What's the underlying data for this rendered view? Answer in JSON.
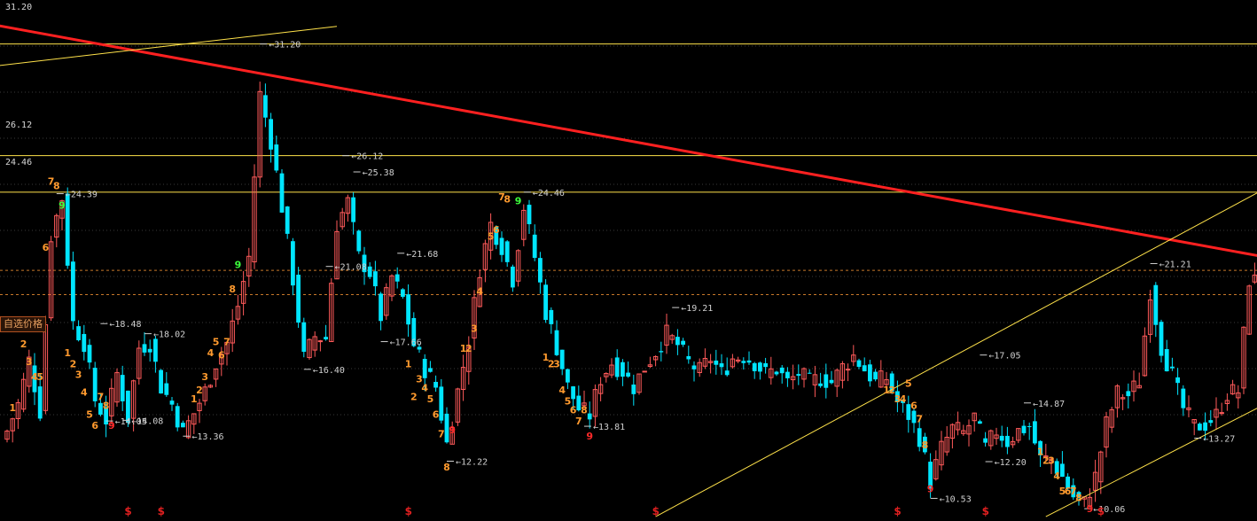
{
  "levels": {
    "top": "31.20",
    "l2612": "26.12",
    "l2446": "24.46"
  },
  "price_tag": "自选价格",
  "flag_glyph": "$",
  "colors": {
    "up": "#ff5a5a",
    "down": "#00e5ff",
    "trend": "#ff2020",
    "level": "#ffe24a",
    "grid": "#3a3a3a",
    "dash": "#c8782a",
    "count_orange": "#ff9a2e",
    "count_green": "#3cff3c",
    "count_red": "#ff2a2a"
  },
  "chart_data": {
    "type": "candlestick",
    "x": "bar index",
    "y_range": [
      9.5,
      33.2
    ],
    "horizontal_levels": [
      31.2,
      26.12,
      24.46
    ],
    "dashed_levels": [
      20.9,
      19.8
    ],
    "trendline": {
      "from": [
        -3,
        32.1
      ],
      "to": [
        228,
        21.55
      ],
      "color": "red"
    },
    "highlow_labels": [
      {
        "i": 46,
        "y": 31.2,
        "text": "31.20"
      },
      {
        "i": 9,
        "y": 24.39,
        "text": "24.39"
      },
      {
        "i": 61,
        "y": 26.12,
        "text": "26.12"
      },
      {
        "i": 63,
        "y": 25.38,
        "text": "25.38"
      },
      {
        "i": 71,
        "y": 21.68,
        "text": "21.68"
      },
      {
        "i": 58,
        "y": 21.08,
        "text": "21.08"
      },
      {
        "i": 68,
        "y": 17.66,
        "text": "17.66"
      },
      {
        "i": 17,
        "y": 18.48,
        "text": "18.48"
      },
      {
        "i": 25,
        "y": 18.02,
        "text": "18.02"
      },
      {
        "i": 18,
        "y": 14.05,
        "text": "14.05"
      },
      {
        "i": 21,
        "y": 14.08,
        "text": "14.08"
      },
      {
        "i": 32,
        "y": 13.36,
        "text": "13.36"
      },
      {
        "i": 54,
        "y": 16.4,
        "text": "16.40"
      },
      {
        "i": 94,
        "y": 24.46,
        "text": "24.46"
      },
      {
        "i": 80,
        "y": 12.22,
        "text": "12.22"
      },
      {
        "i": 105,
        "y": 13.81,
        "text": "13.81"
      },
      {
        "i": 121,
        "y": 19.21,
        "text": "19.21"
      },
      {
        "i": 177,
        "y": 17.05,
        "text": "17.05"
      },
      {
        "i": 178,
        "y": 12.2,
        "text": "12.20"
      },
      {
        "i": 185,
        "y": 14.87,
        "text": "14.87"
      },
      {
        "i": 168,
        "y": 10.53,
        "text": "10.53"
      },
      {
        "i": 196,
        "y": 10.06,
        "text": "10.06"
      },
      {
        "i": 208,
        "y": 21.21,
        "text": "21.21"
      },
      {
        "i": 216,
        "y": 13.27,
        "text": "13.27"
      }
    ],
    "counts": [
      {
        "i": 1,
        "t": "1",
        "c": "o",
        "y": 14.5
      },
      {
        "i": 3,
        "t": "2",
        "c": "o",
        "y": 17.4
      },
      {
        "i": 4,
        "t": "3",
        "c": "o",
        "y": 16.6
      },
      {
        "i": 5,
        "t": "4",
        "c": "o",
        "y": 15.9
      },
      {
        "i": 6,
        "t": "5",
        "c": "o",
        "y": 15.9
      },
      {
        "i": 7,
        "t": "6",
        "c": "o",
        "y": 21.8
      },
      {
        "i": 8,
        "t": "7",
        "c": "o",
        "y": 24.8
      },
      {
        "i": 9,
        "t": "8",
        "c": "o",
        "y": 24.6
      },
      {
        "i": 10,
        "t": "9",
        "c": "g",
        "y": 23.7
      },
      {
        "i": 11,
        "t": "1",
        "c": "o",
        "y": 17.0
      },
      {
        "i": 12,
        "t": "2",
        "c": "o",
        "y": 16.5
      },
      {
        "i": 13,
        "t": "3",
        "c": "o",
        "y": 16.0
      },
      {
        "i": 14,
        "t": "4",
        "c": "o",
        "y": 15.2
      },
      {
        "i": 15,
        "t": "5",
        "c": "o",
        "y": 14.2
      },
      {
        "i": 16,
        "t": "6",
        "c": "o",
        "y": 13.7
      },
      {
        "i": 17,
        "t": "7",
        "c": "o",
        "y": 15.0
      },
      {
        "i": 18,
        "t": "8",
        "c": "o",
        "y": 14.6
      },
      {
        "i": 19,
        "t": "9",
        "c": "r",
        "y": 13.7
      },
      {
        "i": 34,
        "t": "1",
        "c": "o",
        "y": 14.9
      },
      {
        "i": 35,
        "t": "2",
        "c": "o",
        "y": 15.3
      },
      {
        "i": 36,
        "t": "3",
        "c": "o",
        "y": 15.9
      },
      {
        "i": 37,
        "t": "4",
        "c": "o",
        "y": 17.0
      },
      {
        "i": 38,
        "t": "5",
        "c": "o",
        "y": 17.5
      },
      {
        "i": 39,
        "t": "6",
        "c": "o",
        "y": 16.9
      },
      {
        "i": 40,
        "t": "7",
        "c": "o",
        "y": 17.5
      },
      {
        "i": 41,
        "t": "8",
        "c": "o",
        "y": 19.9
      },
      {
        "i": 42,
        "t": "9",
        "c": "g",
        "y": 21.0
      },
      {
        "i": 73,
        "t": "1",
        "c": "o",
        "y": 16.5
      },
      {
        "i": 74,
        "t": "2",
        "c": "o",
        "y": 15.0
      },
      {
        "i": 75,
        "t": "3",
        "c": "o",
        "y": 15.8
      },
      {
        "i": 76,
        "t": "4",
        "c": "o",
        "y": 15.4
      },
      {
        "i": 77,
        "t": "5",
        "c": "o",
        "y": 14.9
      },
      {
        "i": 78,
        "t": "6",
        "c": "o",
        "y": 14.2
      },
      {
        "i": 79,
        "t": "7",
        "c": "o",
        "y": 13.3
      },
      {
        "i": 80,
        "t": "8",
        "c": "o",
        "y": 11.8
      },
      {
        "i": 81,
        "t": "9",
        "c": "r",
        "y": 13.5
      },
      {
        "i": 83,
        "t": "1",
        "c": "o",
        "y": 17.2
      },
      {
        "i": 84,
        "t": "2",
        "c": "o",
        "y": 17.2
      },
      {
        "i": 85,
        "t": "3",
        "c": "o",
        "y": 18.1
      },
      {
        "i": 86,
        "t": "4",
        "c": "o",
        "y": 19.8
      },
      {
        "i": 88,
        "t": "5",
        "c": "o",
        "y": 22.3
      },
      {
        "i": 89,
        "t": "6",
        "c": "o",
        "y": 22.6
      },
      {
        "i": 90,
        "t": "7",
        "c": "o",
        "y": 24.1
      },
      {
        "i": 91,
        "t": "8",
        "c": "o",
        "y": 24.0
      },
      {
        "i": 93,
        "t": "9",
        "c": "g",
        "y": 23.9
      },
      {
        "i": 98,
        "t": "1",
        "c": "o",
        "y": 16.8
      },
      {
        "i": 99,
        "t": "2",
        "c": "o",
        "y": 16.5
      },
      {
        "i": 100,
        "t": "3",
        "c": "o",
        "y": 16.5
      },
      {
        "i": 101,
        "t": "4",
        "c": "o",
        "y": 15.3
      },
      {
        "i": 102,
        "t": "5",
        "c": "o",
        "y": 14.8
      },
      {
        "i": 103,
        "t": "6",
        "c": "o",
        "y": 14.4
      },
      {
        "i": 104,
        "t": "7",
        "c": "o",
        "y": 13.9
      },
      {
        "i": 105,
        "t": "8",
        "c": "o",
        "y": 14.4
      },
      {
        "i": 106,
        "t": "9",
        "c": "r",
        "y": 13.2
      },
      {
        "i": 160,
        "t": "1",
        "c": "o",
        "y": 15.3
      },
      {
        "i": 161,
        "t": "2",
        "c": "o",
        "y": 15.3
      },
      {
        "i": 162,
        "t": "3",
        "c": "o",
        "y": 14.9
      },
      {
        "i": 163,
        "t": "4",
        "c": "o",
        "y": 14.9
      },
      {
        "i": 164,
        "t": "5",
        "c": "o",
        "y": 15.6
      },
      {
        "i": 165,
        "t": "6",
        "c": "o",
        "y": 14.6
      },
      {
        "i": 166,
        "t": "7",
        "c": "o",
        "y": 14.0
      },
      {
        "i": 167,
        "t": "8",
        "c": "o",
        "y": 12.8
      },
      {
        "i": 168,
        "t": "9",
        "c": "r",
        "y": 10.8
      },
      {
        "i": 188,
        "t": "1",
        "c": "o",
        "y": 12.5
      },
      {
        "i": 189,
        "t": "2",
        "c": "o",
        "y": 12.1
      },
      {
        "i": 190,
        "t": "3",
        "c": "o",
        "y": 12.1
      },
      {
        "i": 191,
        "t": "4",
        "c": "o",
        "y": 11.4
      },
      {
        "i": 192,
        "t": "5",
        "c": "o",
        "y": 10.7
      },
      {
        "i": 193,
        "t": "6",
        "c": "o",
        "y": 10.7
      },
      {
        "i": 194,
        "t": "7",
        "c": "o",
        "y": 10.7
      },
      {
        "i": 195,
        "t": "8",
        "c": "o",
        "y": 10.4
      },
      {
        "i": 197,
        "t": "9",
        "c": "r",
        "y": 9.9
      }
    ],
    "flags": [
      22,
      28,
      73,
      118,
      162,
      178,
      199
    ],
    "channel": {
      "upper": {
        "from": [
          118,
          9.7
        ],
        "to": [
          228,
          24.5
        ]
      },
      "lower": {
        "from": [
          189,
          9.7
        ],
        "to": [
          228,
          14.7
        ]
      }
    },
    "top_fan_line": {
      "from": [
        -2,
        30.2
      ],
      "to": [
        60,
        32.0
      ]
    }
  }
}
